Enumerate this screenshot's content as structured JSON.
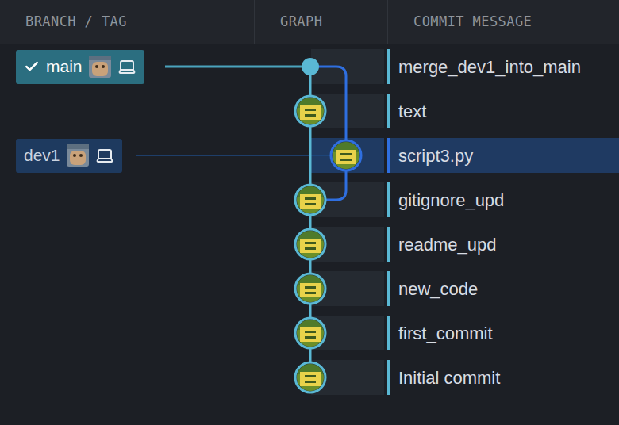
{
  "header": {
    "columns": [
      "BRANCH / TAG",
      "GRAPH",
      "COMMIT MESSAGE"
    ]
  },
  "branches": [
    {
      "name": "main",
      "checked_out": true,
      "commit": 0,
      "color": "#2b6e80"
    },
    {
      "name": "dev1",
      "checked_out": false,
      "commit": 2,
      "color": "#1e3a5f"
    }
  ],
  "commits": [
    {
      "message": "merge_dev1_into_main",
      "lane": "main",
      "kind": "merge",
      "selected": false
    },
    {
      "message": "text",
      "lane": "main",
      "kind": "commit",
      "selected": false
    },
    {
      "message": "script3.py",
      "lane": "dev1",
      "kind": "commit",
      "selected": true
    },
    {
      "message": "gitignore_upd",
      "lane": "main",
      "kind": "commit",
      "selected": false
    },
    {
      "message": "readme_upd",
      "lane": "main",
      "kind": "commit",
      "selected": false
    },
    {
      "message": "new_code",
      "lane": "main",
      "kind": "commit",
      "selected": false
    },
    {
      "message": "first_commit",
      "lane": "main",
      "kind": "commit",
      "selected": false
    },
    {
      "message": "Initial commit",
      "lane": "main",
      "kind": "commit",
      "selected": false
    }
  ]
}
